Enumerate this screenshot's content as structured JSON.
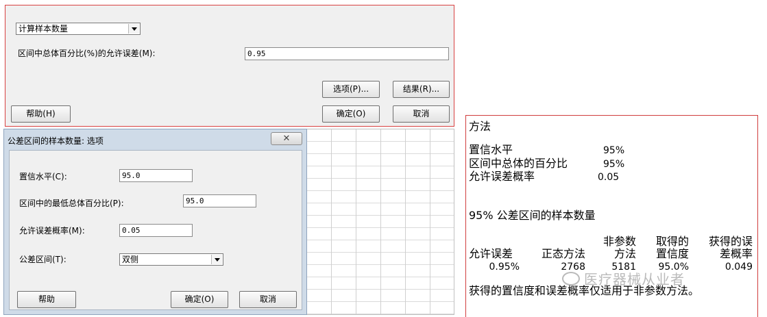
{
  "main_dialog": {
    "dropdown_value": "计算样本数量",
    "field_label": "区间中总体百分比(%)的允许误差(M):",
    "field_value": "0.95",
    "options_button": "选项(P)...",
    "results_button": "结果(R)...",
    "help_button": "帮助(H)",
    "ok_button": "确定(O)",
    "cancel_button": "取消"
  },
  "options_dialog": {
    "title": "公差区间的样本数量: 选项",
    "close_glyph": "✕",
    "confidence_label": "置信水平(C):",
    "confidence_value": "95.0",
    "min_pct_label": "区间中的最低总体百分比(P):",
    "min_pct_value": "95.0",
    "error_prob_label": "允许误差概率(M):",
    "error_prob_value": "0.05",
    "interval_label": "公差区间(T):",
    "interval_value": "双侧",
    "help_button": "帮助",
    "ok_button": "确定(O)",
    "cancel_button": "取消"
  },
  "output": {
    "method_heading": "方法",
    "confidence_label": "置信水平",
    "confidence_value": "95%",
    "pct_label": "区间中总体的百分比",
    "pct_value": "95%",
    "error_label": "允许误差概率",
    "error_value": "0.05",
    "section_heading": "95% 公差区间的样本数量",
    "table": {
      "headers": {
        "allowed_error": "允许误差",
        "normal_method": "正态方法",
        "nonparam_line1": "非参数",
        "nonparam_line2": "方法",
        "achieved_line1": "取得的",
        "achieved_line2": "置信度",
        "obtained_line1": "获得的误",
        "obtained_line2": "差概率"
      },
      "row": {
        "allowed_error": "0.95%",
        "normal_method": "2768",
        "nonparam": "5181",
        "achieved": "95.0%",
        "obtained": "0.049"
      }
    },
    "footnote": "获得的置信度和误差概率仅适用于非参数方法。"
  },
  "watermark": "医疗器械从业者"
}
